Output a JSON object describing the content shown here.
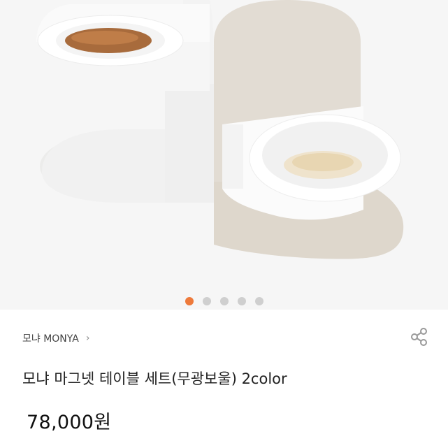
{
  "product_image": {
    "icon": "cat-bowl-table-set-photo",
    "carousel": {
      "total": 5,
      "active_index": 0
    }
  },
  "brand": {
    "name": "모냐 MONYA",
    "chevron": "›"
  },
  "product": {
    "title": "모냐 마그넷 테이블 세트(무광보울) 2color",
    "price": "78,000원"
  },
  "colors": {
    "active_dot": "#ee7a3b",
    "inactive_dot": "#cfcfcf"
  },
  "icons": {
    "share": "share-icon"
  }
}
